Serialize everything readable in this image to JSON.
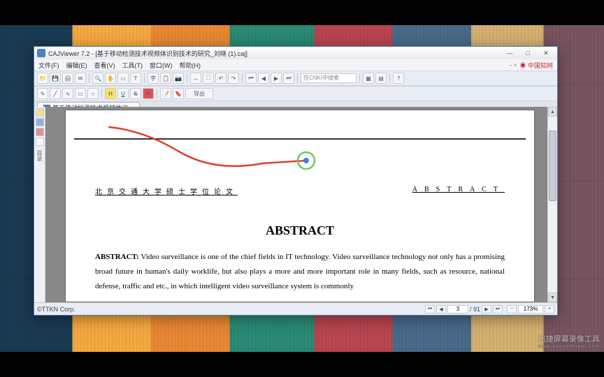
{
  "window": {
    "title": "CAJViewer 7.2 - [基于移动检测技术视频体识别技术的研究_刘晓 (1).caj]",
    "min": "—",
    "max": "□",
    "close": "✕"
  },
  "menu": {
    "file": "文件(F)",
    "edit": "编辑(E)",
    "view": "查看(V)",
    "tools": "工具(T)",
    "window": "窗口(W)",
    "help": "帮助(H)",
    "cnki": "中国知网",
    "minus": "– ×"
  },
  "toolbar": {
    "search_placeholder": "在CNKI中搜索"
  },
  "tab": {
    "label": "基于移动检测技术视频体识..."
  },
  "sidebar": {
    "label": "目录"
  },
  "document": {
    "header_cn": "北京交通大学硕士学位论文",
    "header_en": "ABSTRACT",
    "title": "ABSTRACT",
    "body_label": "ABSTRACT:",
    "body": "Video surveillance is one of the chief fields in IT technology. Video surveillance technology not only has a promising broad future in human's daily worklife, but also plays a more and more important role in many fields, such as resource, national defense, traffic and etc., in which intelligent video surveillance system is commonly"
  },
  "status": {
    "copyright": "©TTKN Corp.",
    "page_current": "3",
    "page_total": "/ 91",
    "zoom": "173%"
  },
  "watermark": {
    "line1": "迅捷屏幕录像工具",
    "line2": "www.xunjieshipin.com"
  }
}
